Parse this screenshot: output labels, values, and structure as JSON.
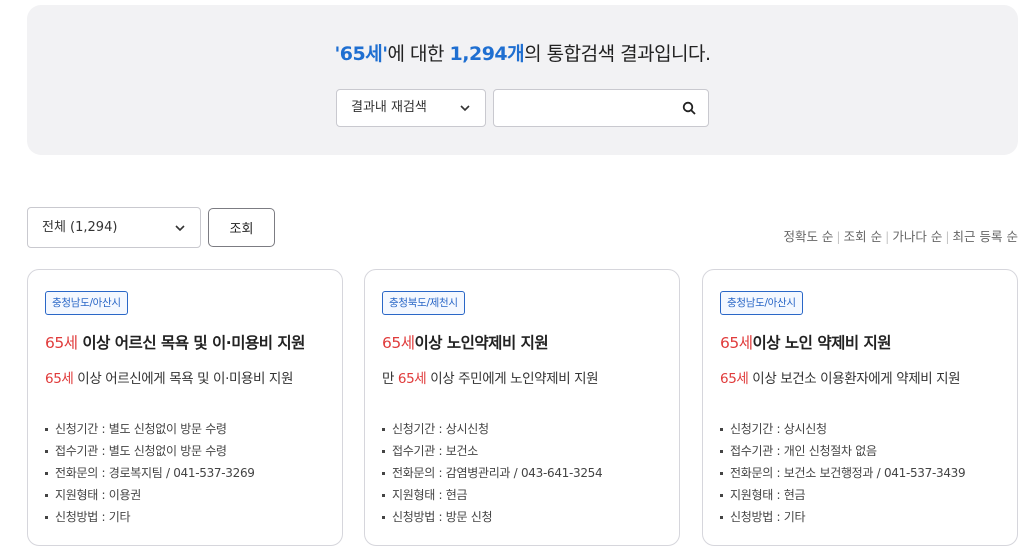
{
  "search": {
    "keyword": "65세",
    "heading_mid": "에 대한 ",
    "count": "1,294개",
    "heading_tail": "의 통합검색 결과입니다.",
    "scope_label": "결과내 재검색",
    "input_value": "",
    "input_placeholder": ""
  },
  "filter": {
    "selected": "전체 (1,294)",
    "button_label": "조회"
  },
  "sort": {
    "options": [
      "정확도 순",
      "조회 순",
      "가나다 순",
      "최근 등록 순"
    ]
  },
  "cards": [
    {
      "region": "충청남도/아산시",
      "title_kw": "65세",
      "title_rest": " 이상 어르신 목욕 및 이·미용비 지원",
      "desc_pre": "",
      "desc_kw": "65세",
      "desc_rest": " 이상 어르신에게 목욕 및 이·미용비 지원",
      "info": [
        "신청기간 : 별도 신청없이 방문 수령",
        "접수기관 : 별도 신청없이 방문 수령",
        "전화문의 : 경로복지팀 / 041-537-3269",
        "지원형태 : 이용권",
        "신청방법 : 기타"
      ]
    },
    {
      "region": "충청북도/제천시",
      "title_kw": "65세",
      "title_rest": "이상 노인약제비 지원",
      "desc_pre": "만 ",
      "desc_kw": "65세",
      "desc_rest": " 이상 주민에게 노인약제비 지원",
      "info": [
        "신청기간 : 상시신청",
        "접수기관 : 보건소",
        "전화문의 : 감염병관리과 / 043-641-3254",
        "지원형태 : 현금",
        "신청방법 : 방문 신청"
      ]
    },
    {
      "region": "충청남도/아산시",
      "title_kw": "65세",
      "title_rest": "이상 노인 약제비 지원",
      "desc_pre": "",
      "desc_kw": "65세",
      "desc_rest": " 이상 보건소 이용환자에게 약제비 지원",
      "info": [
        "신청기간 : 상시신청",
        "접수기관 : 개인 신청절차 없음",
        "전화문의 : 보건소 보건행정과 / 041-537-3439",
        "지원형태 : 현금",
        "신청방법 : 기타"
      ]
    }
  ],
  "colors": {
    "accent_blue": "#1f6fd1",
    "keyword_red": "#e03b3b",
    "panel_bg": "#f2f2f4"
  },
  "icons": {
    "search": "search-icon",
    "dropdown": "chevron-down-icon"
  }
}
